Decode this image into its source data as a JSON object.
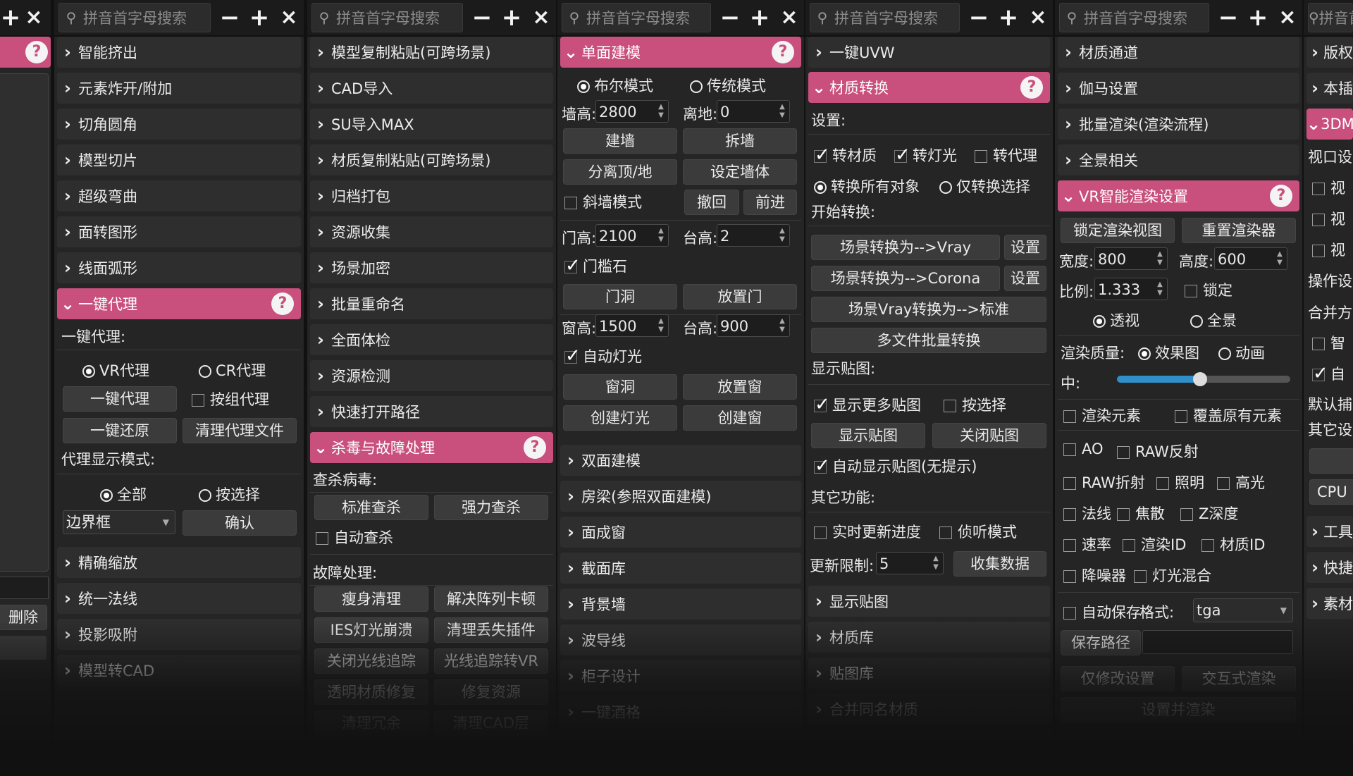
{
  "search_placeholder": "拼音首字母搜索",
  "accent": "#c94f7c",
  "col0": {
    "delete_label": "删除"
  },
  "col1": {
    "items": [
      "智能挤出",
      "元素炸开/附加",
      "切角圆角",
      "模型切片",
      "超级弯曲",
      "面转图形",
      "线面弧形"
    ],
    "active": "一键代理",
    "section_label": "一键代理:",
    "radio_vr": "VR代理",
    "radio_cr": "CR代理",
    "btn_proxy": "一键代理",
    "cb_group": "按组代理",
    "btn_restore": "一键还原",
    "btn_clean": "清理代理文件",
    "display_mode_label": "代理显示模式:",
    "radio_all": "全部",
    "radio_select": "按选择",
    "dropdown_value": "边界框",
    "btn_confirm": "确认",
    "items2": [
      "精确缩放",
      "统一法线",
      "投影吸附",
      "模型转CAD"
    ]
  },
  "col2": {
    "items": [
      "模型复制粘贴(可跨场景)",
      "CAD导入",
      "SU导入MAX",
      "材质复制粘贴(可跨场景)",
      "归档打包",
      "资源收集",
      "场景加密",
      "批量重命名",
      "全面体检",
      "资源检测",
      "快速打开路径"
    ],
    "active": "杀毒与故障处理",
    "virus_label": "查杀病毒:",
    "btn_std": "标准查杀",
    "btn_strong": "强力查杀",
    "cb_auto": "自动查杀",
    "fault_label": "故障处理:",
    "btn_slim": "瘦身清理",
    "btn_array": "解决阵列卡顿",
    "btn_ies": "IES灯光崩溃",
    "btn_plugin": "清理丢失插件",
    "btn_raytrace": "关闭光线追踪",
    "btn_raytrace_vr": "光线追踪转VR",
    "btn_transparent": "透明材质修复",
    "btn_resource": "修复资源",
    "btn_row5a": "清理冗余",
    "btn_row5b": "清理CAD层"
  },
  "col3": {
    "active": "单面建模",
    "radio_bool": "布尔模式",
    "radio_trad": "传统模式",
    "wall_h_label": "墙高:",
    "wall_h": "2800",
    "ground_label": "离地:",
    "ground": "0",
    "btn_build_wall": "建墙",
    "btn_split_wall": "拆墙",
    "btn_sep_top": "分离顶/地",
    "btn_set_wall": "设定墙体",
    "cb_slant": "斜墙模式",
    "btn_undo": "撤回",
    "btn_redo": "前进",
    "door_h_label": "门高:",
    "door_h": "2100",
    "sill_label": "台高:",
    "sill": "2",
    "cb_threshold": "门槛石",
    "btn_door_hole": "门洞",
    "btn_place_door": "放置门",
    "win_h_label": "窗高:",
    "win_h": "1500",
    "win_sill_label": "台高:",
    "win_sill": "900",
    "cb_auto_light": "自动灯光",
    "btn_win_hole": "窗洞",
    "btn_place_win": "放置窗",
    "btn_create_light": "创建灯光",
    "btn_create_win": "创建窗",
    "items": [
      "双面建模",
      "房梁(参照双面建模)",
      "面成窗",
      "截面库",
      "背景墙",
      "波导线",
      "柜子设计",
      "一键酒格"
    ]
  },
  "col4": {
    "item_top": "一键UVW",
    "active": "材质转换",
    "settings_label": "设置:",
    "cb_mat": "转材质",
    "cb_light": "转灯光",
    "cb_proxy": "转代理",
    "radio_all": "转换所有对象",
    "radio_sel": "仅转换选择",
    "start_label": "开始转换:",
    "btn_to_vray": "场景转换为-->Vray",
    "btn_set1": "设置",
    "btn_to_corona": "场景转换为-->Corona",
    "btn_set2": "设置",
    "btn_vray_std": "场景Vray转换为-->标准",
    "btn_batch": "多文件批量转换",
    "display_tex_label": "显示贴图:",
    "cb_more_tex": "显示更多贴图",
    "cb_by_sel": "按选择",
    "btn_show_tex": "显示贴图",
    "btn_close_tex": "关闭贴图",
    "cb_auto_tex": "自动显示贴图(无提示)",
    "other_label": "其它功能:",
    "cb_realtime": "实时更新进度",
    "cb_listen": "侦听模式",
    "limit_label": "更新限制:",
    "limit_value": "5",
    "btn_collect": "收集数据",
    "items": [
      "显示贴图",
      "材质库",
      "贴图库",
      "合并同名材质"
    ]
  },
  "col5": {
    "items": [
      "材质通道",
      "伽马设置",
      "批量渲染(渲染流程)",
      "全景相关"
    ],
    "active": "VR智能渲染设置",
    "btn_lock": "锁定渲染视图",
    "btn_reset": "重置渲染器",
    "width_label": "宽度:",
    "width": "800",
    "height_label": "高度:",
    "height": "600",
    "ratio_label": "比例:",
    "ratio": "1.333",
    "cb_lock": "锁定",
    "radio_persp": "透视",
    "radio_pano": "全景",
    "quality_label": "渲染质量:",
    "radio_effect": "效果图",
    "radio_anim": "动画",
    "slider_label": "中:",
    "slider_value": 0.48,
    "cb_render_el": "渲染元素",
    "cb_override": "覆盖原有元素",
    "cb_ao": "AO",
    "cb_raw_refl": "RAW反射",
    "cb_raw_refr": "RAW折射",
    "cb_lighting": "照明",
    "cb_highlight": "高光",
    "cb_normal": "法线",
    "cb_caustic": "焦散",
    "cb_zdepth": "Z深度",
    "cb_velocity": "速率",
    "cb_render_id": "渲染ID",
    "cb_mat_id": "材质ID",
    "cb_denoiser": "降噪器",
    "cb_light_mix": "灯光混合",
    "cb_autosave": "自动保存",
    "format_label": "格式:",
    "format_value": "tga",
    "btn_save_path": "保存路径",
    "btn_modify": "仅修改设置",
    "btn_interactive": "交互式渲染",
    "btn_set_render": "设置并渲染"
  },
  "col6": {
    "items_top": [
      "版权",
      "本插"
    ],
    "active": "3DM",
    "viewport_label": "视口设",
    "cbs": [
      "视",
      "视",
      "视"
    ],
    "op_label": "操作设",
    "merge_label": "合并方",
    "cb_smart": "智",
    "cb_auto": "自",
    "default_label": "默认捕",
    "other_label": "其它设",
    "btn_cpu": "CPU",
    "items_bottom": [
      "工具",
      "快捷",
      "素材"
    ]
  }
}
